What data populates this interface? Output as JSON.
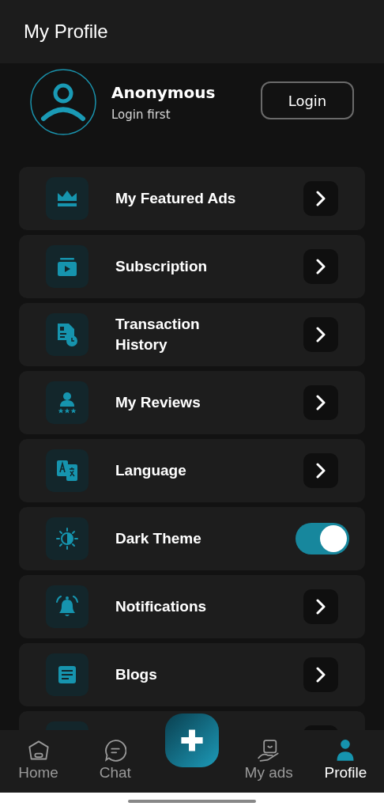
{
  "header": {
    "title": "My Profile"
  },
  "profile": {
    "name": "Anonymous",
    "subtitle": "Login first",
    "button": "Login"
  },
  "menu": [
    {
      "kind": "link",
      "label": "My Featured Ads"
    },
    {
      "kind": "link",
      "label": "Subscription"
    },
    {
      "kind": "link",
      "label": "Transaction History"
    },
    {
      "kind": "link",
      "label": "My Reviews"
    },
    {
      "kind": "link",
      "label": "Language"
    },
    {
      "kind": "toggle",
      "label": "Dark Theme",
      "on": true
    },
    {
      "kind": "link",
      "label": "Notifications"
    },
    {
      "kind": "link",
      "label": "Blogs"
    },
    {
      "kind": "link"
    }
  ],
  "nav": [
    {
      "kind": "tab",
      "label": "Home",
      "selected": false
    },
    {
      "kind": "tab",
      "label": "Chat",
      "selected": false
    },
    {
      "kind": "add"
    },
    {
      "kind": "tab",
      "label": "My ads",
      "selected": false
    },
    {
      "kind": "tab",
      "label": "Profile",
      "selected": true
    }
  ]
}
